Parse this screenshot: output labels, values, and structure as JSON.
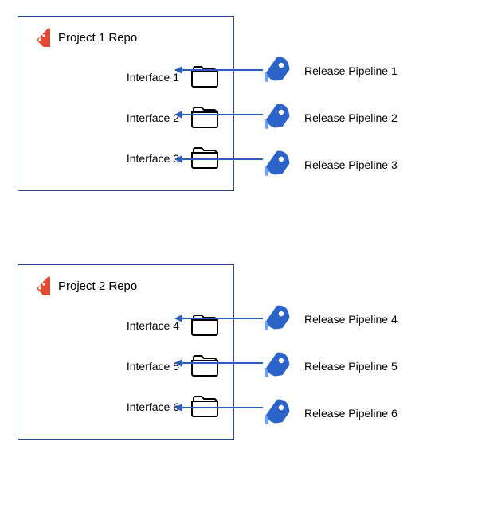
{
  "repos": [
    {
      "title": "Project 1 Repo",
      "interfaces": [
        {
          "label": "Interface 1"
        },
        {
          "label": "Interface 2"
        },
        {
          "label": "Interface 3"
        }
      ]
    },
    {
      "title": "Project 2 Repo",
      "interfaces": [
        {
          "label": "Interface 4"
        },
        {
          "label": "Interface 5"
        },
        {
          "label": "Interface 6"
        }
      ]
    }
  ],
  "pipelines_group1": [
    {
      "label": "Release Pipeline 1"
    },
    {
      "label": "Release Pipeline 2"
    },
    {
      "label": "Release Pipeline 3"
    }
  ],
  "pipelines_group2": [
    {
      "label": "Release Pipeline 4"
    },
    {
      "label": "Release Pipeline 5"
    },
    {
      "label": "Release Pipeline 6"
    }
  ],
  "colors": {
    "git": "#e24a33",
    "rocket_dark": "#2b63c9",
    "rocket_light": "#6ca2ff",
    "border": "#2b4a8f",
    "arrow": "#2b5bbd"
  }
}
